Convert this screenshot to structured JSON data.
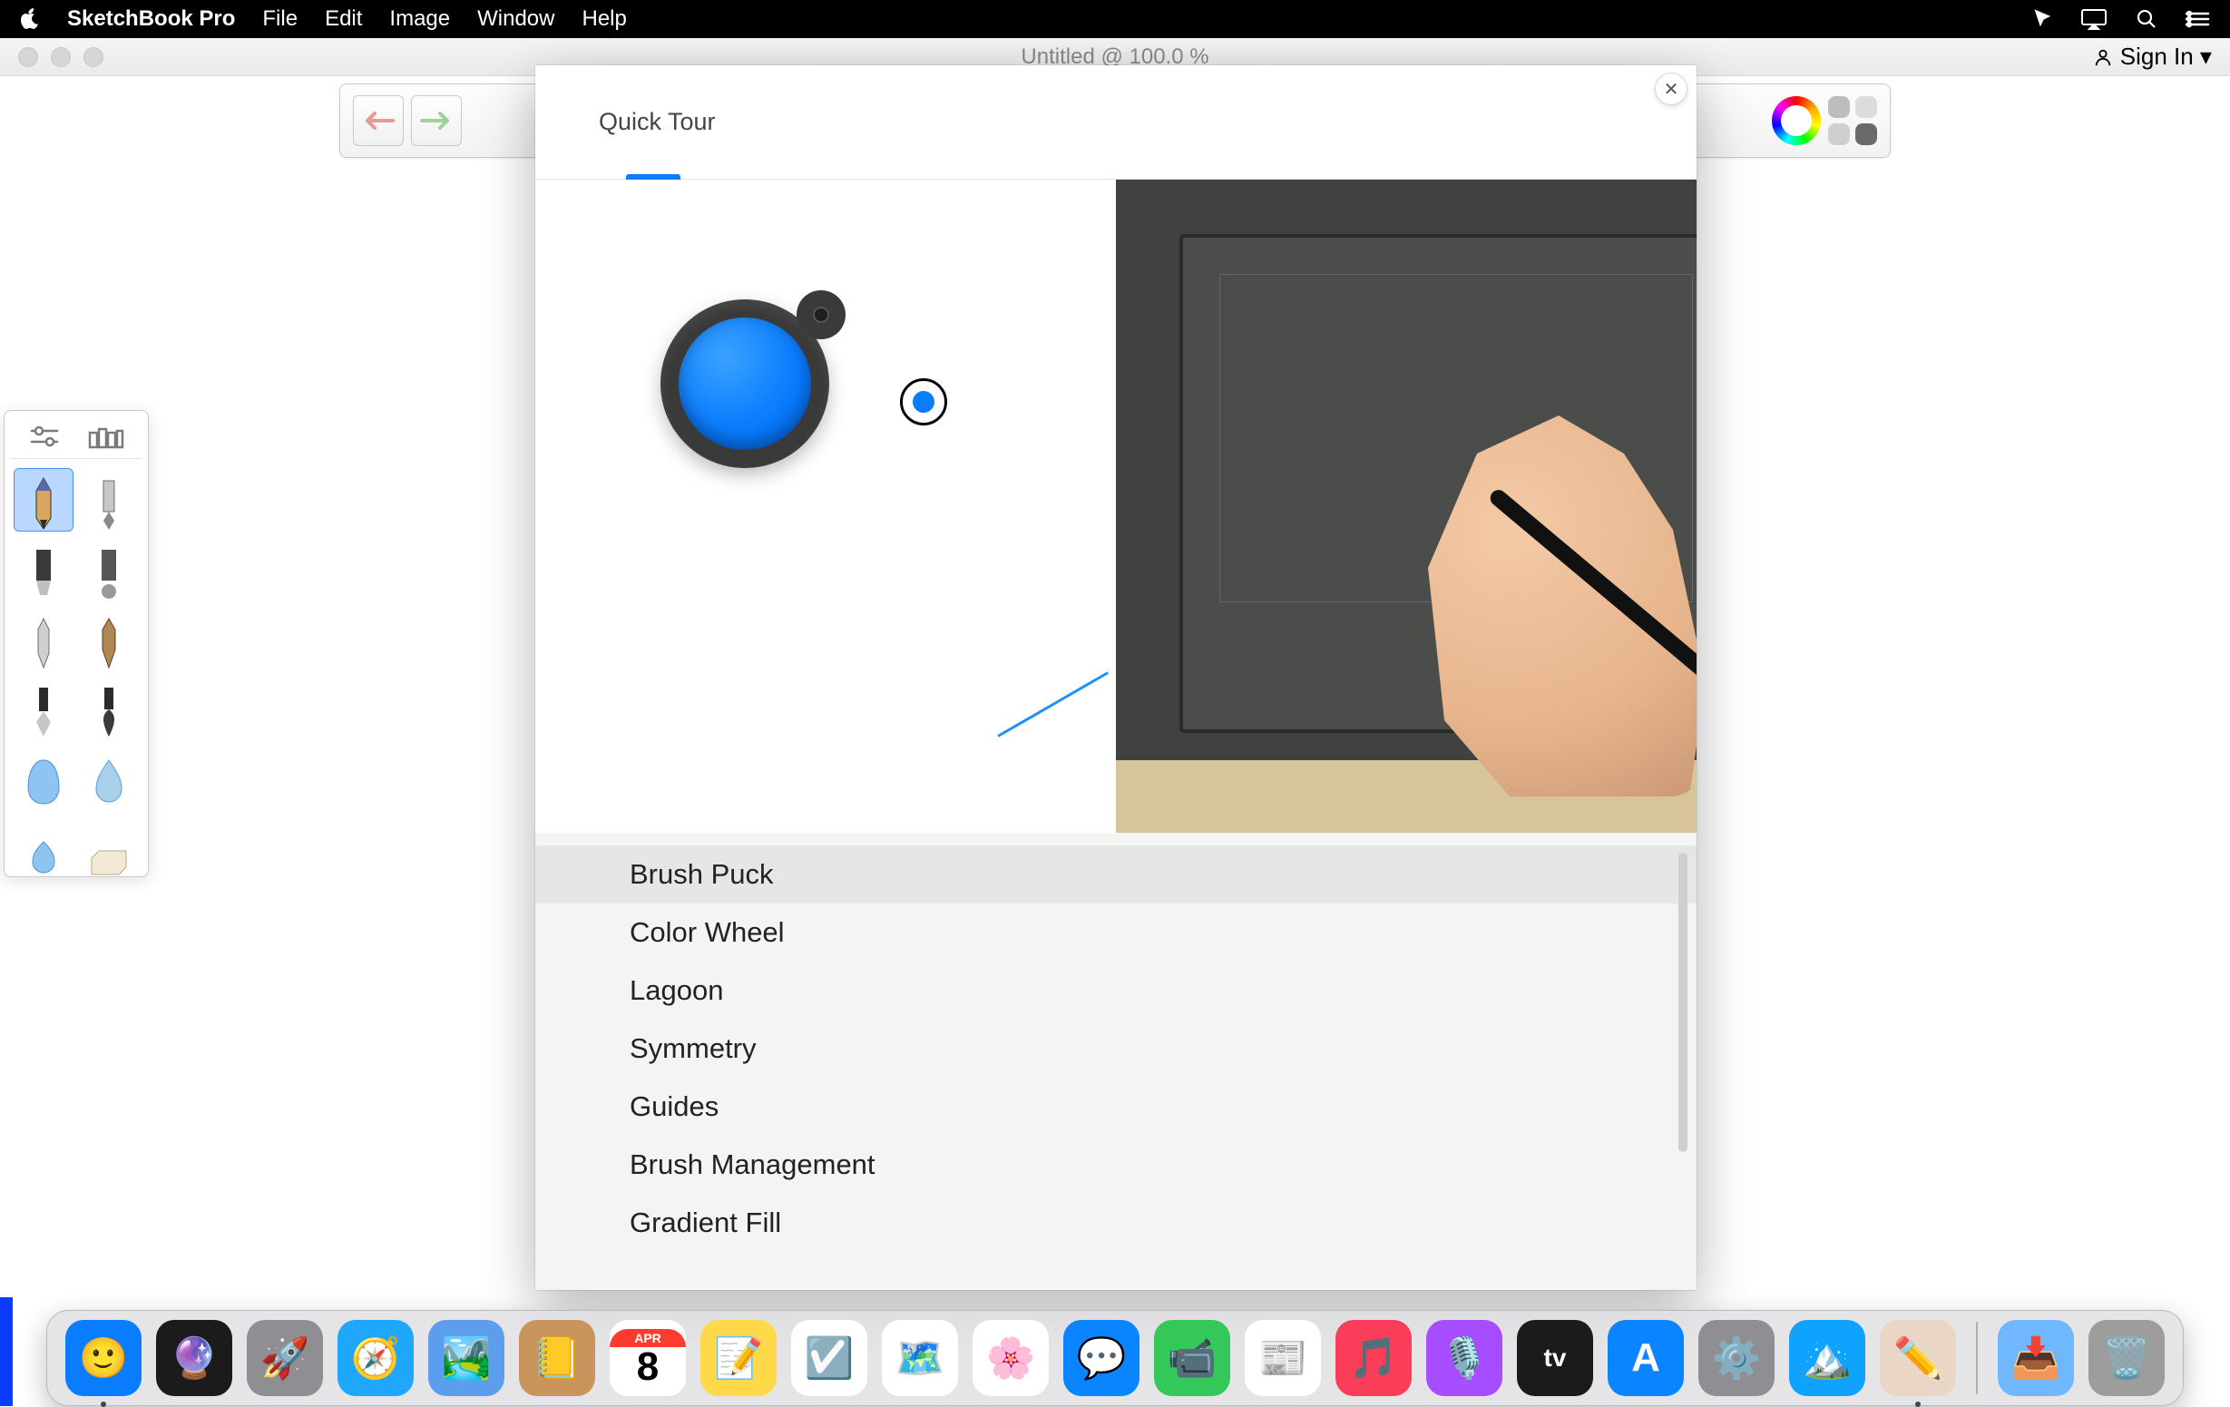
{
  "menubar": {
    "app": "SketchBook Pro",
    "items": [
      "File",
      "Edit",
      "Image",
      "Window",
      "Help"
    ]
  },
  "window": {
    "title": "Untitled @ 100.0 %",
    "sign_in": "Sign In ▾"
  },
  "modal": {
    "title": "Quick Tour",
    "close_label": "✕",
    "items": [
      "Brush Puck",
      "Color Wheel",
      "Lagoon",
      "Symmetry",
      "Guides",
      "Brush Management",
      "Gradient Fill"
    ],
    "active_index": 0
  },
  "brushes": {
    "tools": [
      "pencil",
      "technical-pen",
      "marker-chisel",
      "marker-soft",
      "fine-pen",
      "brush-pen",
      "ink-nib",
      "ink-brush",
      "soft-round-blue",
      "water-drop",
      "soft-eraser-blue",
      "hard-eraser"
    ],
    "selected_index": 0
  },
  "dock": {
    "items": [
      {
        "name": "finder",
        "color": "#0a7dff",
        "emoji": "🙂",
        "running": true
      },
      {
        "name": "siri",
        "color": "#1b1b1b",
        "emoji": "🔮"
      },
      {
        "name": "launchpad",
        "color": "#8e8e93",
        "emoji": "🚀"
      },
      {
        "name": "safari",
        "color": "#1ea7fd",
        "emoji": "🧭"
      },
      {
        "name": "preview",
        "color": "#5c9ded",
        "emoji": "🏞️"
      },
      {
        "name": "contacts",
        "color": "#c9955c",
        "emoji": "📒"
      },
      {
        "name": "calendar",
        "color": "#ffffff",
        "emoji": "8",
        "text": true,
        "badge": "APR"
      },
      {
        "name": "notes",
        "color": "#ffd94a",
        "emoji": "📝"
      },
      {
        "name": "reminders",
        "color": "#ffffff",
        "emoji": "☑️"
      },
      {
        "name": "maps",
        "color": "#ffffff",
        "emoji": "🗺️"
      },
      {
        "name": "photos",
        "color": "#ffffff",
        "emoji": "🌸"
      },
      {
        "name": "messages",
        "color": "#0a84ff",
        "emoji": "💬"
      },
      {
        "name": "facetime",
        "color": "#34c759",
        "emoji": "📹"
      },
      {
        "name": "news",
        "color": "#ffffff",
        "emoji": "📰"
      },
      {
        "name": "music",
        "color": "#fa3e5a",
        "emoji": "🎵"
      },
      {
        "name": "podcasts",
        "color": "#a64dff",
        "emoji": "🎙️"
      },
      {
        "name": "tv",
        "color": "#1b1b1b",
        "emoji": "tv",
        "text": true,
        "small": true
      },
      {
        "name": "appstore",
        "color": "#0a84ff",
        "emoji": "A",
        "text": true
      },
      {
        "name": "settings",
        "color": "#8e8e93",
        "emoji": "⚙️"
      },
      {
        "name": "affinity",
        "color": "#0fa3ff",
        "emoji": "🏔️"
      },
      {
        "name": "sketchbook",
        "color": "#e9d6c4",
        "emoji": "✏️",
        "running": true
      }
    ],
    "right": [
      {
        "name": "downloads",
        "color": "#6fb7ff",
        "emoji": "📥"
      },
      {
        "name": "trash",
        "color": "#9d9d9d",
        "emoji": "🗑️"
      }
    ]
  }
}
